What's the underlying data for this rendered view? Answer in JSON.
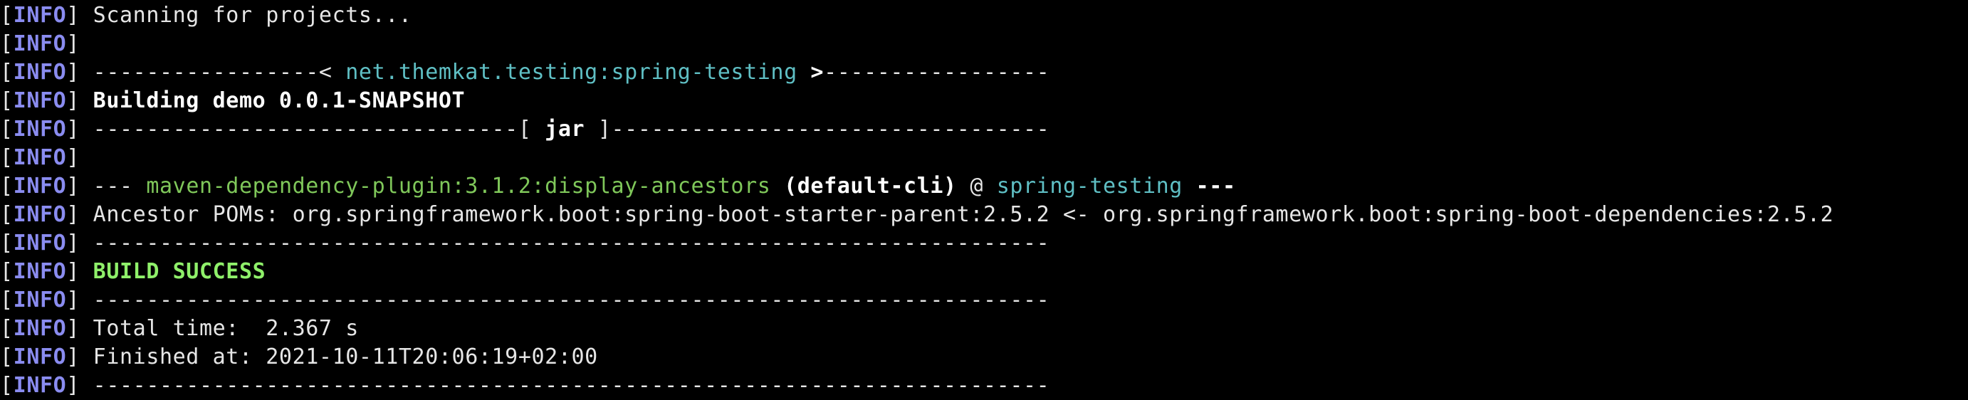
{
  "terminal": {
    "prefix": {
      "open": "[",
      "label": "INFO",
      "close": "]"
    },
    "lines": [
      {
        "segments": [
          {
            "text": "Scanning for projects...",
            "style": "plain"
          }
        ]
      },
      {
        "segments": []
      },
      {
        "segments": [
          {
            "text": "-----------------< ",
            "style": "plain"
          },
          {
            "text": "net.themkat.testing:spring-testing",
            "style": "cyan"
          },
          {
            "text": " >",
            "style": "bold"
          },
          {
            "text": "-----------------",
            "style": "plain"
          }
        ]
      },
      {
        "segments": [
          {
            "text": "Building demo 0.0.1-SNAPSHOT",
            "style": "bold"
          }
        ]
      },
      {
        "segments": [
          {
            "text": "--------------------------------[ ",
            "style": "plain"
          },
          {
            "text": "jar",
            "style": "bold"
          },
          {
            "text": " ]---------------------------------",
            "style": "plain"
          }
        ]
      },
      {
        "segments": []
      },
      {
        "segments": [
          {
            "text": "--- ",
            "style": "plain"
          },
          {
            "text": "maven-dependency-plugin:3.1.2:display-ancestors",
            "style": "green"
          },
          {
            "text": " (default-cli)",
            "style": "bold"
          },
          {
            "text": " @ ",
            "style": "plain"
          },
          {
            "text": "spring-testing",
            "style": "cyan"
          },
          {
            "text": " ---",
            "style": "bold"
          }
        ]
      },
      {
        "segments": [
          {
            "text": "Ancestor POMs: org.springframework.boot:spring-boot-starter-parent:2.5.2 <- org.springframework.boot:spring-boot-dependencies:2.5.2",
            "style": "plain"
          }
        ]
      },
      {
        "segments": [
          {
            "text": "------------------------------------------------------------------------",
            "style": "plain"
          }
        ]
      },
      {
        "segments": [
          {
            "text": "BUILD SUCCESS",
            "style": "success"
          }
        ]
      },
      {
        "segments": [
          {
            "text": "------------------------------------------------------------------------",
            "style": "plain"
          }
        ]
      },
      {
        "segments": [
          {
            "text": "Total time:  2.367 s",
            "style": "plain"
          }
        ]
      },
      {
        "segments": [
          {
            "text": "Finished at: 2021-10-11T20:06:19+02:00",
            "style": "plain"
          }
        ]
      },
      {
        "segments": [
          {
            "text": "------------------------------------------------------------------------",
            "style": "plain"
          }
        ]
      }
    ]
  },
  "colors": {
    "background": "#000000",
    "info": "#8a8cf0",
    "text": "#e6e6e6",
    "cyan": "#5fbfc4",
    "green": "#7fc75a",
    "success": "#8ff06a"
  }
}
